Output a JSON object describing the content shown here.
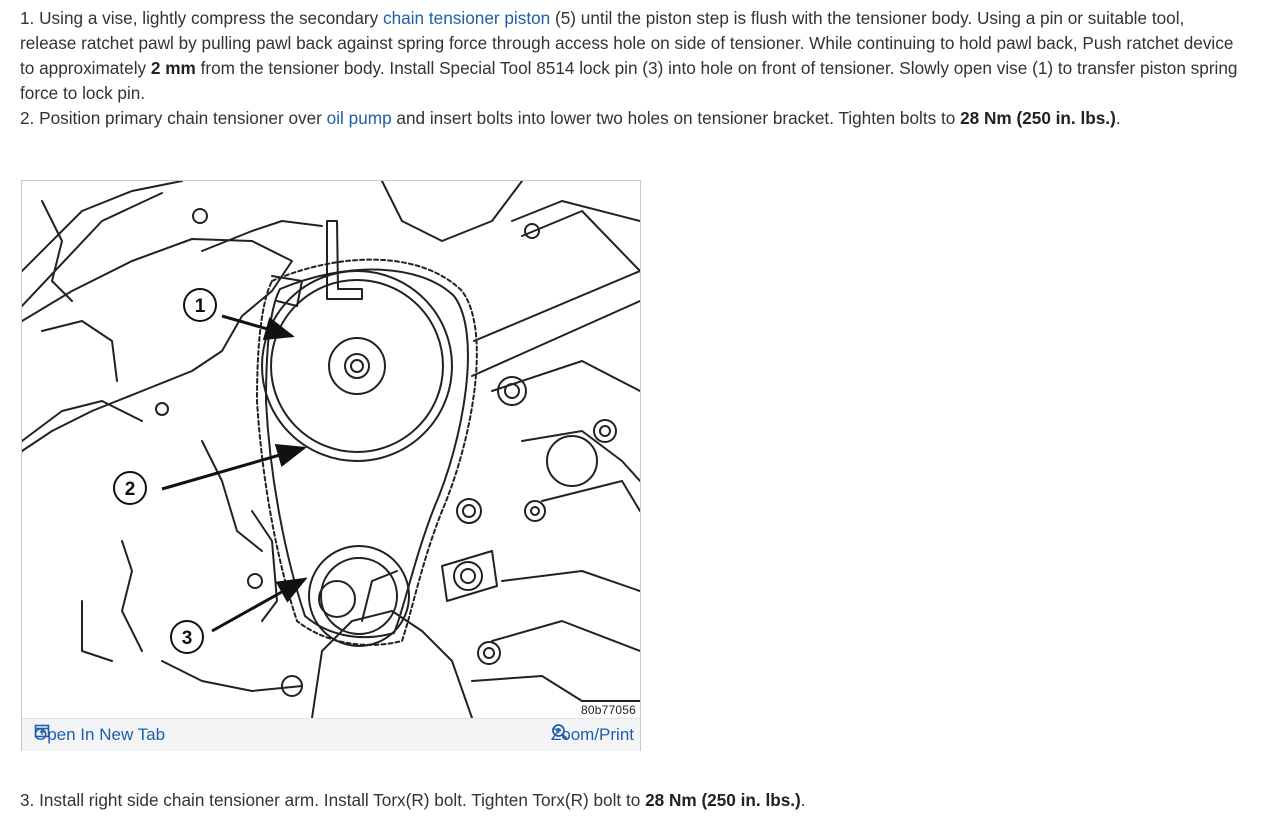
{
  "steps": [
    {
      "num": "1.",
      "t1": " Using a vise, lightly compress the secondary ",
      "link1": "chain tensioner piston",
      "t2": " (5) until the piston step is flush with the tensioner body. Using a pin or suitable tool, release ratchet pawl by pulling pawl back against spring force through access hole on side of tensioner. While continuing to hold pawl back, Push ratchet device to approximately ",
      "b1": "2 mm",
      "t3": " from the tensioner body. Install Special Tool 8514 lock pin (3) into hole on front of tensioner. Slowly open vise (1) to transfer piston spring force to lock pin."
    },
    {
      "num": "2.",
      "t1": " Position primary chain tensioner over ",
      "link1": "oil pump",
      "t2": " and insert bolts into lower two holes on tensioner bracket. Tighten bolts to ",
      "b1": "28 Nm (250 in. lbs.)",
      "t3": "."
    },
    {
      "num": "3.",
      "t1": " Install right side chain tensioner arm. Install Torx(R) bolt. Tighten Torx(R) bolt to ",
      "b1": "28 Nm (250 in. lbs.)",
      "t3": "."
    }
  ],
  "figure": {
    "code": "80b77056",
    "callouts": [
      "1",
      "2",
      "3"
    ],
    "open_tab_label": "Open In New Tab",
    "zoom_label": "Zoom/Print",
    "open_tab_icon": "open-external-icon",
    "zoom_icon": "zoom-in-icon",
    "link_color": "#1f5fa8"
  }
}
